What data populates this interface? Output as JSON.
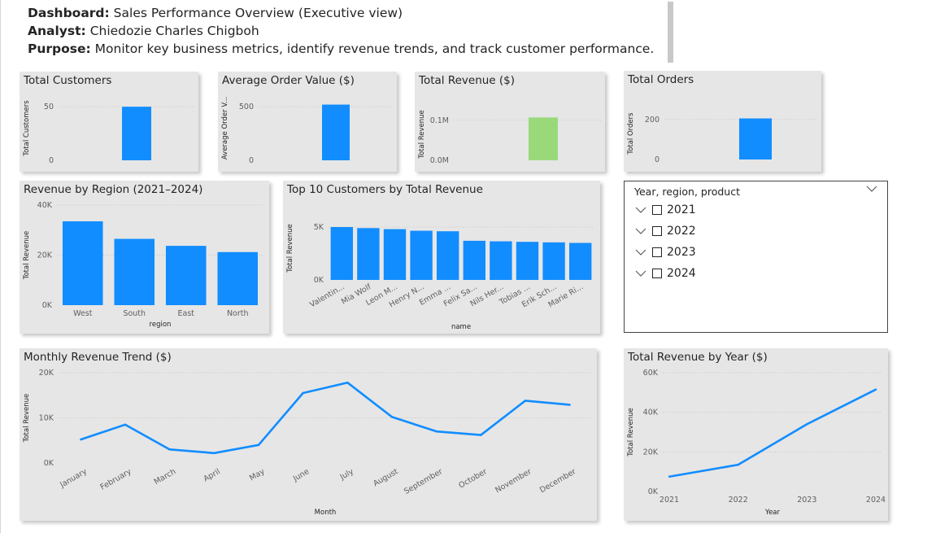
{
  "header": {
    "dashboard_label": "Dashboard:",
    "dashboard_value": "Sales Performance Overview (Executive view)",
    "analyst_label": "Analyst:",
    "analyst_value": "Chiedozie Charles Chigboh",
    "purpose_label": "Purpose:",
    "purpose_value": "Monitor key business metrics, identify revenue trends, and track customer performance."
  },
  "colors": {
    "bar": "#118dff",
    "revenue_bar": "#99d97a",
    "tile_bg": "#e6e6e6"
  },
  "slicer": {
    "title": "Year, region, product",
    "items": [
      {
        "label": "2021"
      },
      {
        "label": "2022"
      },
      {
        "label": "2023"
      },
      {
        "label": "2024"
      }
    ]
  },
  "chart_data": [
    {
      "id": "total-customers",
      "type": "bar",
      "title": "Total Customers",
      "ylabel": "Total Customers",
      "xlabel": "",
      "yticks": [
        "0",
        "50"
      ],
      "tick_values": [
        0,
        50
      ],
      "ylim": [
        0,
        60
      ],
      "values": [
        50
      ],
      "color": "#118dff",
      "grid": true
    },
    {
      "id": "avg-order-value",
      "type": "bar",
      "title": "Average Order Value ($)",
      "ylabel": "Average Order V...",
      "xlabel": "",
      "yticks": [
        "0",
        "500"
      ],
      "tick_values": [
        0,
        500
      ],
      "ylim": [
        0,
        600
      ],
      "values": [
        520
      ],
      "color": "#118dff",
      "grid": true
    },
    {
      "id": "total-revenue",
      "type": "bar",
      "title": "Total Revenue ($)",
      "ylabel": "Total Revenue",
      "xlabel": "",
      "yticks": [
        "0.0M",
        "0.1M"
      ],
      "tick_values": [
        0,
        0.1
      ],
      "ylim": [
        0,
        0.13
      ],
      "values": [
        0.107
      ],
      "color": "#99d97a",
      "grid": true
    },
    {
      "id": "total-orders",
      "type": "bar",
      "title": "Total Orders",
      "ylabel": "Total Orders",
      "xlabel": "",
      "yticks": [
        "0",
        "200"
      ],
      "tick_values": [
        0,
        200
      ],
      "ylim": [
        0,
        260
      ],
      "values": [
        205
      ],
      "color": "#118dff",
      "grid": true
    },
    {
      "id": "revenue-by-region",
      "type": "bar",
      "title": "Revenue by Region (2021–2024)",
      "ylabel": "Total Revenue",
      "xlabel": "region",
      "categories": [
        "West",
        "South",
        "East",
        "North"
      ],
      "values": [
        33500,
        26500,
        23700,
        21200
      ],
      "yticks": [
        "0K",
        "20K",
        "40K"
      ],
      "tick_values": [
        0,
        20000,
        40000
      ],
      "ylim": [
        0,
        40000
      ],
      "color": "#118dff",
      "grid": true
    },
    {
      "id": "top-10-customers",
      "type": "bar",
      "title": "Top 10 Customers by Total Revenue",
      "ylabel": "Total Revenue",
      "xlabel": "name",
      "categories": [
        "Valentin...",
        "Mia Wolf",
        "Leon M...",
        "Henry N...",
        "Emma ...",
        "Felix Sa...",
        "Nils Her...",
        "Tobias ...",
        "Erik Sch...",
        "Marie Ri..."
      ],
      "values": [
        5000,
        4900,
        4800,
        4650,
        4600,
        3700,
        3650,
        3600,
        3550,
        3500
      ],
      "yticks": [
        "0K",
        "5K"
      ],
      "tick_values": [
        0,
        5000
      ],
      "ylim": [
        0,
        6000
      ],
      "color": "#118dff",
      "grid": true
    },
    {
      "id": "monthly-revenue-trend",
      "type": "line",
      "title": "Monthly Revenue Trend ($)",
      "ylabel": "Total Revenue",
      "xlabel": "Month",
      "categories": [
        "January",
        "February",
        "March",
        "April",
        "May",
        "June",
        "July",
        "August",
        "September",
        "October",
        "November",
        "December"
      ],
      "values": [
        5200,
        8500,
        3000,
        2200,
        4000,
        15500,
        17800,
        10200,
        7000,
        6200,
        13800,
        12900
      ],
      "yticks": [
        "0K",
        "10K",
        "20K"
      ],
      "tick_values": [
        0,
        10000,
        20000
      ],
      "ylim": [
        0,
        20000
      ],
      "color": "#118dff",
      "grid": true
    },
    {
      "id": "total-revenue-by-year",
      "type": "line",
      "title": "Total Revenue by Year ($)",
      "ylabel": "Total Revenue",
      "xlabel": "Year",
      "categories": [
        "2021",
        "2022",
        "2023",
        "2024"
      ],
      "values": [
        7500,
        13500,
        34000,
        51500
      ],
      "yticks": [
        "0K",
        "20K",
        "40K",
        "60K"
      ],
      "tick_values": [
        0,
        20000,
        40000,
        60000
      ],
      "ylim": [
        0,
        60000
      ],
      "color": "#118dff",
      "grid": true
    }
  ]
}
